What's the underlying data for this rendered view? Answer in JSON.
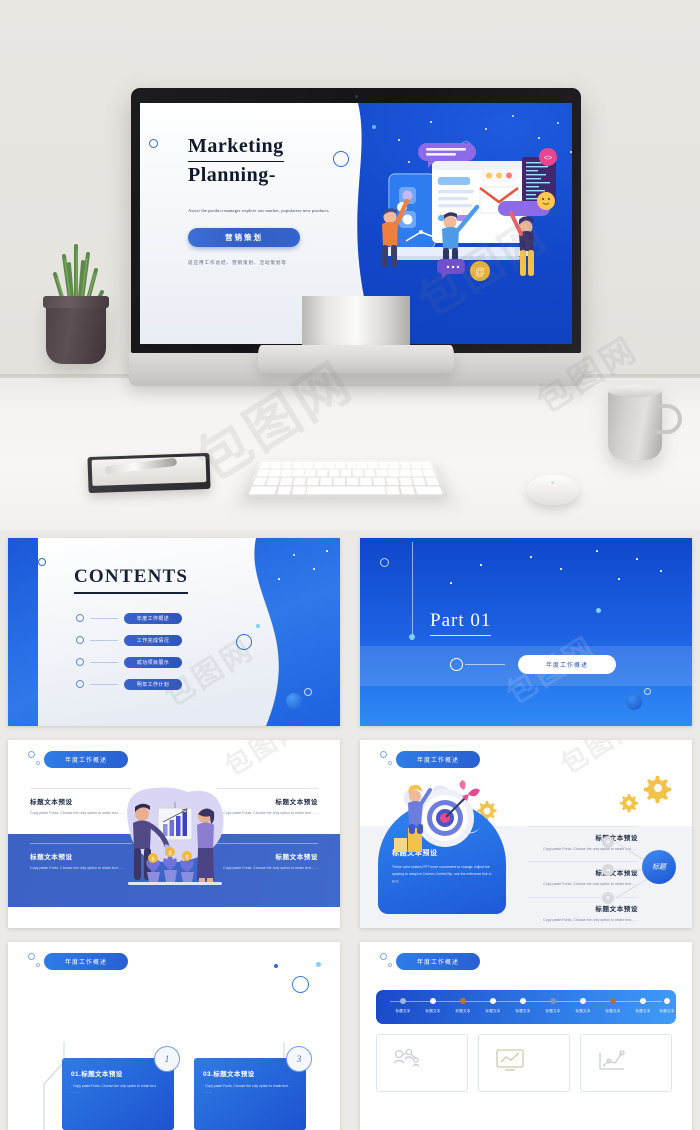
{
  "scene": {
    "description": "desktop-monitor-mockup",
    "objects": [
      "monitor",
      "keyboard",
      "mouse",
      "coffee-mug",
      "potted-plant",
      "notebook",
      "pen"
    ]
  },
  "watermark": {
    "text": "包图网"
  },
  "hero_slide": {
    "title_line1": "Marketing",
    "title_line2": "Planning-",
    "subtitle": "Assist the product manager explore our market, popularize new products.",
    "button_label": "营销策划",
    "note": "适应用工作总结、营销策划、活动策划等",
    "colors": {
      "bg_blue": "#1247c9",
      "accent": "#3564ce",
      "panel": "#f5f7fa"
    }
  },
  "contents_slide": {
    "title": "CONTENTS",
    "items": [
      {
        "label": "年度工作概述"
      },
      {
        "label": "工作完成情况"
      },
      {
        "label": "成功项目展示"
      },
      {
        "label": "明年工作计划"
      }
    ]
  },
  "part_slide": {
    "title": "Part 01",
    "pill_label": "年度工作概述"
  },
  "section_header": {
    "pill_label": "年度工作概述"
  },
  "quad_slide": {
    "blocks": [
      {
        "title": "标题文本预设",
        "body": "Copy paste Fonts. Choose the only option to retain text……"
      },
      {
        "title": "标题文本预设",
        "body": "Copy paste Fonts. Choose the only option to retain text……"
      },
      {
        "title": "标题文本预设",
        "body": "Copy paste Fonts. Choose the only option to retain text……"
      },
      {
        "title": "标题文本预设",
        "body": "Copy paste Fonts. Choose the only option to retain text……"
      }
    ]
  },
  "target_slide": {
    "blob_title": "标题文本预设",
    "blob_body": "These color makes PPT more convenient to change. Adjust the spacing to adapt to Column CenterClip, use the reference line in PPT.",
    "hub_label": "标题",
    "rows": [
      {
        "title": "标题文本预设",
        "body": "Copy paste Fonts. Choose the only option to retain text……",
        "icon": "chart-icon"
      },
      {
        "title": "标题文本预设",
        "body": "Copy paste Fonts. Choose the only option to retain text……",
        "icon": "cloud-icon"
      },
      {
        "title": "标题文本预设",
        "body": "Copy paste Fonts. Choose the only option to retain text……",
        "icon": "user-icon"
      }
    ]
  },
  "cards_slide": {
    "cards": [
      {
        "badge": "1",
        "title": "01.标题文本预设",
        "body": "Copy paste Fonts. Choose the only option to retain text."
      },
      {
        "badge": "3",
        "title": "03.标题文本预设",
        "body": "Copy paste Fonts. Choose the only option to retain text."
      }
    ]
  },
  "timeline_slide": {
    "points": [
      {
        "label": "标题文本",
        "color": "#9fb6da"
      },
      {
        "label": "标题文本",
        "color": "#ffffff"
      },
      {
        "label": "标题文本",
        "color": "#c8702f"
      },
      {
        "label": "标题文本",
        "color": "#ffffff"
      },
      {
        "label": "标题文本",
        "color": "#ffffff"
      },
      {
        "label": "标题文本",
        "color": "#7f93c4"
      },
      {
        "label": "标题文本",
        "color": "#ffffff"
      },
      {
        "label": "标题文本",
        "color": "#b4702f"
      },
      {
        "label": "标题文本",
        "color": "#ffffff"
      },
      {
        "label": "标题文本",
        "color": "#ffffff"
      }
    ],
    "boxes": [
      {
        "icon": "people-network-icon"
      },
      {
        "icon": "chart-screen-icon"
      },
      {
        "icon": "growth-graph-icon"
      }
    ]
  }
}
